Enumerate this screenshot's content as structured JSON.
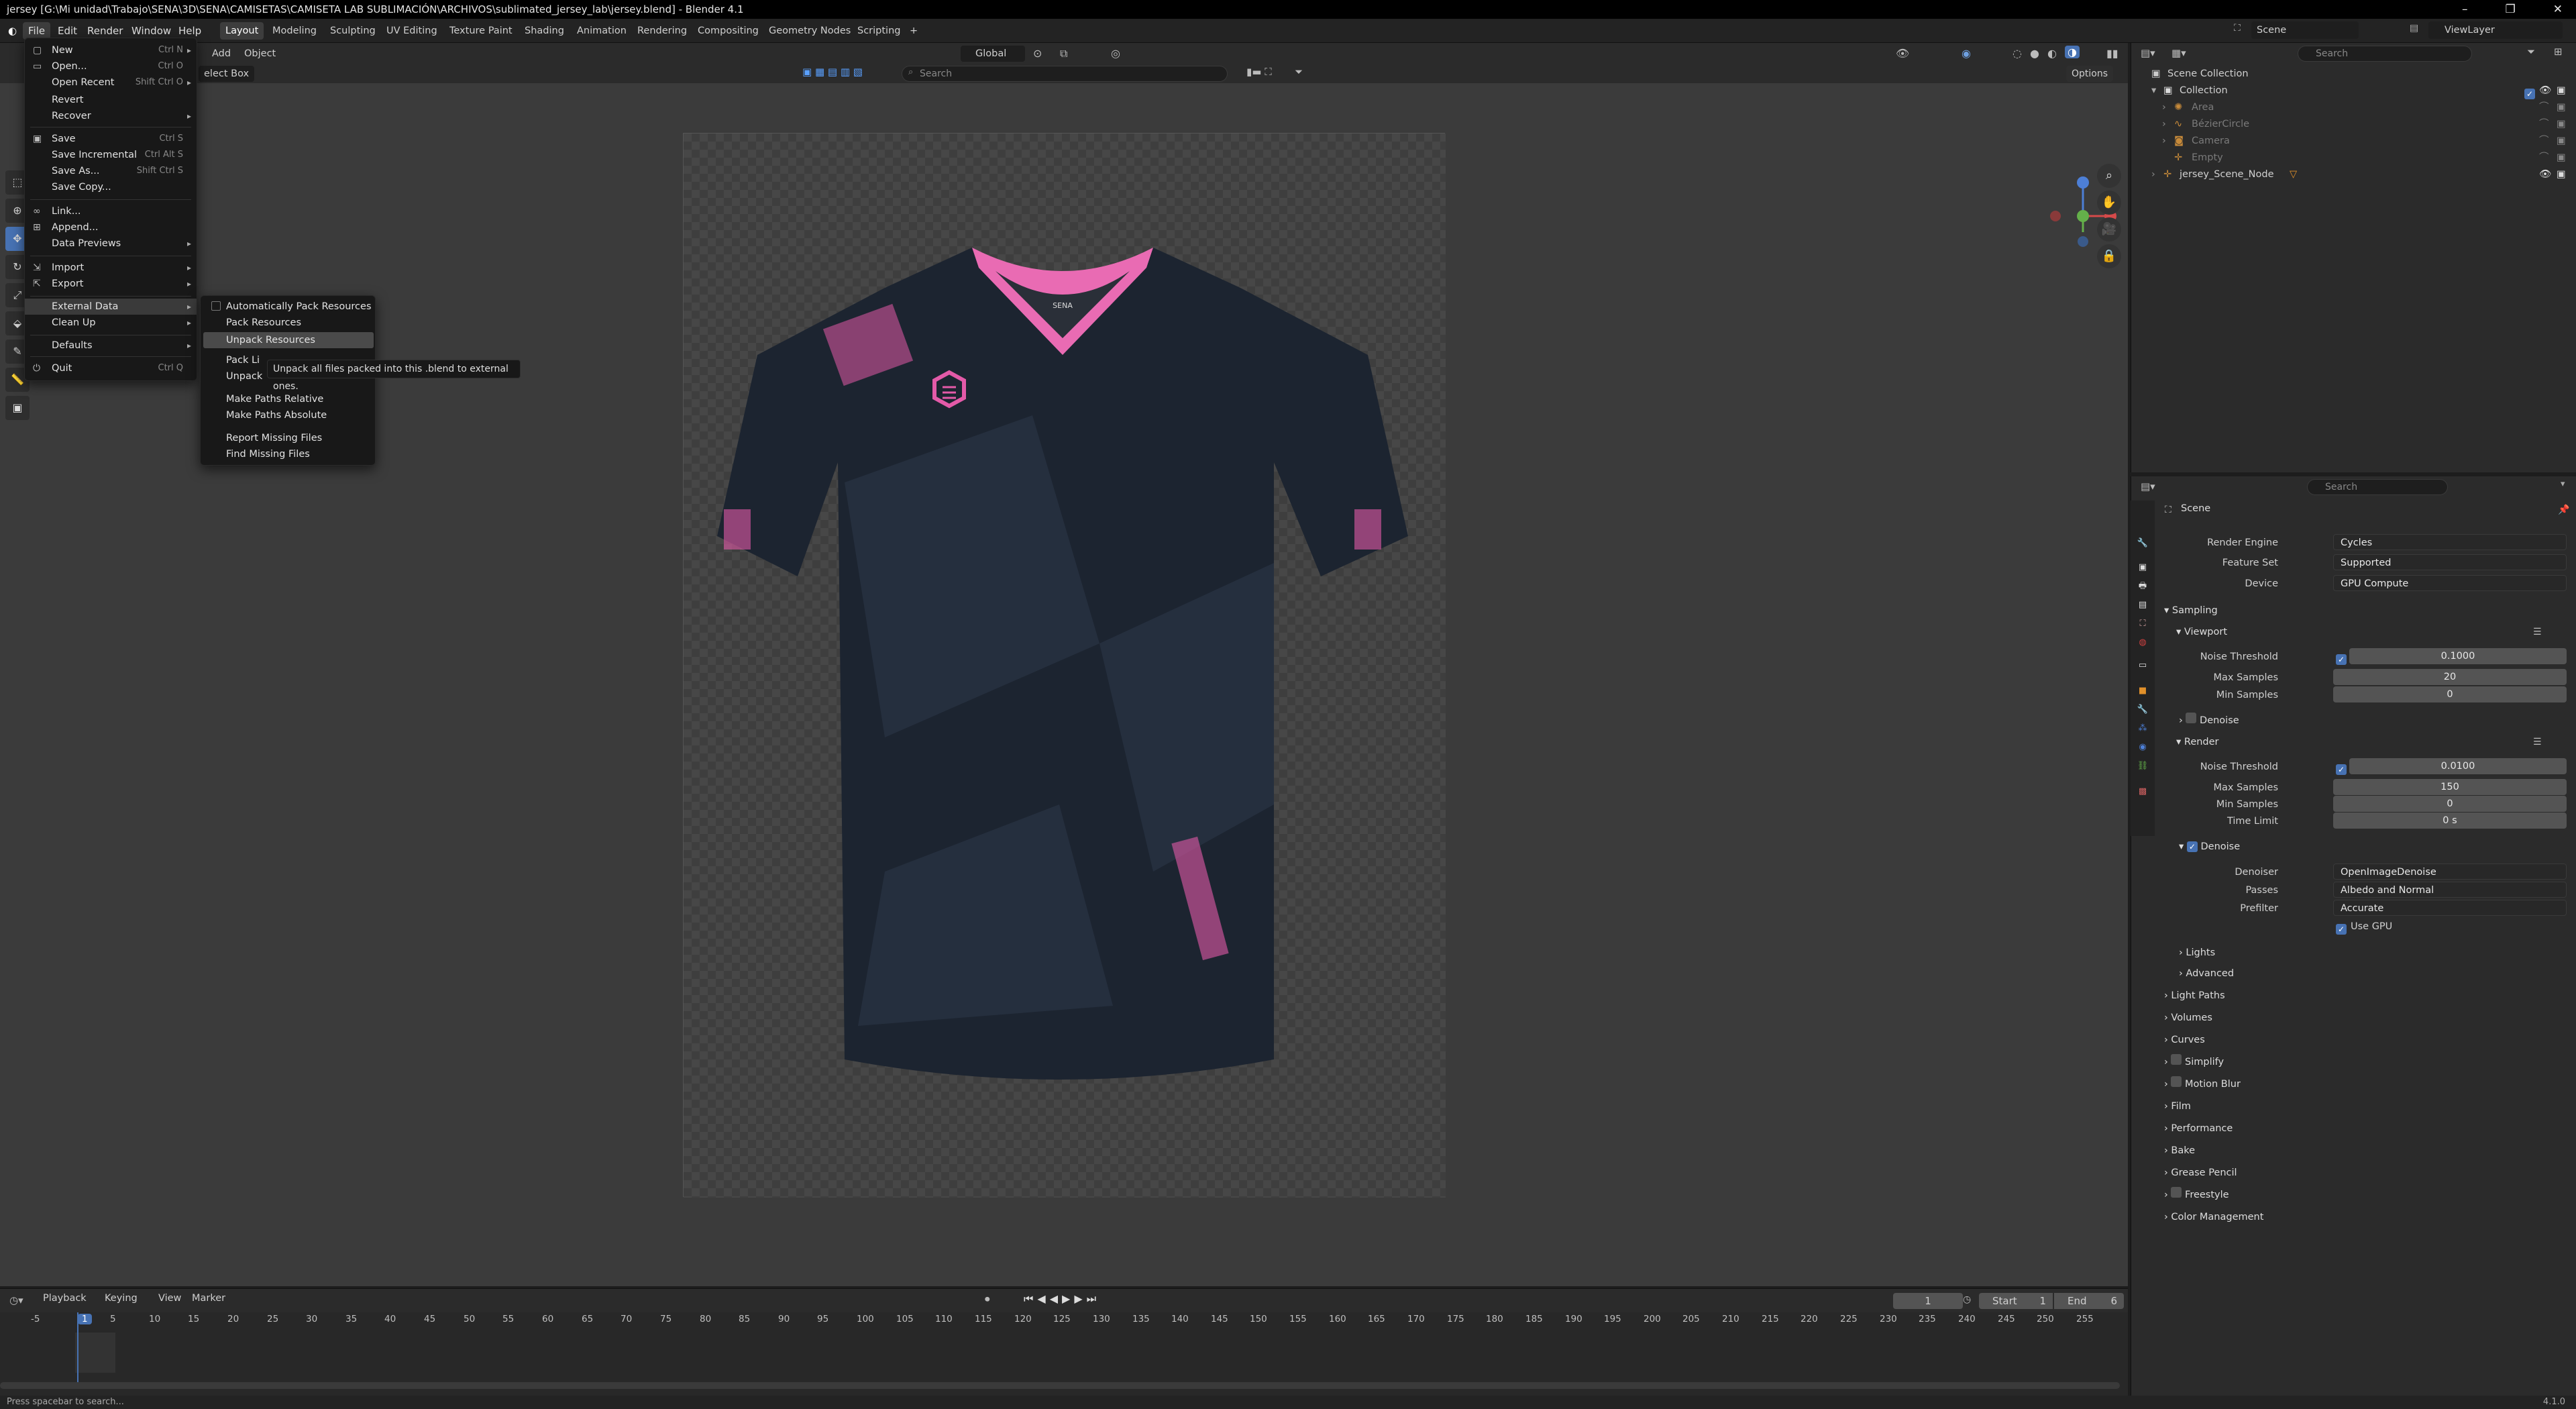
{
  "window": {
    "title": "jersey [G:\\Mi unidad\\Trabajo\\SENA\\3D\\SENA\\CAMISETAS\\CAMISETA LAB SUBLIMACIÓN\\ARCHIVOS\\sublimated_jersey_lab\\jersey.blend] - Blender 4.1",
    "min": "–",
    "max": "❐",
    "close": "✕"
  },
  "menubar": [
    "File",
    "Edit",
    "Render",
    "Window",
    "Help"
  ],
  "workspaces": [
    "Layout",
    "Modeling",
    "Sculpting",
    "UV Editing",
    "Texture Paint",
    "Shading",
    "Animation",
    "Rendering",
    "Compositing",
    "Geometry Nodes",
    "Scripting",
    "+"
  ],
  "scene": {
    "label": "Scene",
    "viewlayer": "ViewLayer"
  },
  "viewport": {
    "add": "Add",
    "object": "Object",
    "select_box": "elect Box",
    "transform": "Global",
    "search_placeholder": "Search",
    "options": "Options"
  },
  "file_menu": [
    {
      "label": "New",
      "shortcut": "Ctrl N",
      "icon": "new-icon",
      "arrow": true
    },
    {
      "label": "Open...",
      "shortcut": "Ctrl O",
      "icon": "folder-icon"
    },
    {
      "label": "Open Recent",
      "shortcut": "Shift Ctrl O",
      "arrow": true
    },
    {
      "label": "Revert"
    },
    {
      "label": "Recover",
      "arrow": true
    },
    {
      "label": "Save",
      "shortcut": "Ctrl S",
      "icon": "save-icon"
    },
    {
      "label": "Save Incremental",
      "shortcut": "Ctrl Alt S"
    },
    {
      "label": "Save As...",
      "shortcut": "Shift Ctrl S"
    },
    {
      "label": "Save Copy..."
    },
    {
      "label": "Link...",
      "icon": "link-icon"
    },
    {
      "label": "Append...",
      "icon": "append-icon"
    },
    {
      "label": "Data Previews",
      "arrow": true
    },
    {
      "label": "Import",
      "arrow": true,
      "icon": "import-icon"
    },
    {
      "label": "Export",
      "arrow": true,
      "icon": "export-icon"
    },
    {
      "label": "External Data",
      "arrow": true,
      "highlight": true
    },
    {
      "label": "Clean Up",
      "arrow": true
    },
    {
      "label": "Defaults",
      "arrow": true
    },
    {
      "label": "Quit",
      "shortcut": "Ctrl Q",
      "icon": "quit-icon"
    }
  ],
  "external_data_menu": [
    {
      "label": "Automatically Pack Resources",
      "checkbox": true
    },
    {
      "label": "Pack Resources"
    },
    {
      "label": "Unpack Resources",
      "highlight": true
    },
    {
      "label": "Pack Li"
    },
    {
      "label": "Unpack"
    },
    {
      "label": "Make Paths Relative"
    },
    {
      "label": "Make Paths Absolute"
    },
    {
      "label": "Report Missing Files"
    },
    {
      "label": "Find Missing Files"
    }
  ],
  "tooltip": "Unpack all files packed into this .blend to external ones.",
  "outliner": {
    "search_placeholder": "Search",
    "items": [
      {
        "label": "Scene Collection",
        "indent": 0,
        "color": "#d0d0d0"
      },
      {
        "label": "Collection",
        "indent": 1,
        "color": "#d0d0d0"
      },
      {
        "label": "Area",
        "indent": 2,
        "color": "#7a7a7a"
      },
      {
        "label": "BézierCircle",
        "indent": 2,
        "color": "#7a7a7a"
      },
      {
        "label": "Camera",
        "indent": 2,
        "color": "#7a7a7a"
      },
      {
        "label": "Empty",
        "indent": 2,
        "color": "#7a7a7a"
      },
      {
        "label": "jersey_Scene_Node",
        "indent": 1,
        "color": "#d0d0d0"
      }
    ]
  },
  "properties": {
    "search_placeholder": "Search",
    "context": "Scene",
    "render_engine": {
      "label": "Render Engine",
      "value": "Cycles"
    },
    "feature_set": {
      "label": "Feature Set",
      "value": "Supported"
    },
    "device": {
      "label": "Device",
      "value": "GPU Compute"
    },
    "sampling": "Sampling",
    "viewport": "Viewport",
    "vp_noise_threshold": {
      "label": "Noise Threshold",
      "value": "0.1000"
    },
    "vp_max_samples": {
      "label": "Max Samples",
      "value": "20"
    },
    "vp_min_samples": {
      "label": "Min Samples",
      "value": "0"
    },
    "vp_denoise": "Denoise",
    "render": "Render",
    "r_noise_threshold": {
      "label": "Noise Threshold",
      "value": "0.0100"
    },
    "r_max_samples": {
      "label": "Max Samples",
      "value": "150"
    },
    "r_min_samples": {
      "label": "Min Samples",
      "value": "0"
    },
    "r_time_limit": {
      "label": "Time Limit",
      "value": "0 s"
    },
    "r_denoise": "Denoise",
    "denoiser": {
      "label": "Denoiser",
      "value": "OpenImageDenoise"
    },
    "passes": {
      "label": "Passes",
      "value": "Albedo and Normal"
    },
    "prefilter": {
      "label": "Prefilter",
      "value": "Accurate"
    },
    "use_gpu": "Use GPU",
    "lights": "Lights",
    "advanced": "Advanced",
    "panels": [
      "Light Paths",
      "Volumes",
      "Curves",
      "Simplify",
      "Motion Blur",
      "Film",
      "Performance",
      "Bake",
      "Grease Pencil",
      "Freestyle",
      "Color Management"
    ]
  },
  "timeline": {
    "menus": [
      "Playback",
      "Keying",
      "View",
      "Marker"
    ],
    "current_frame": "1",
    "start_label": "Start",
    "start": "1",
    "end_label": "End",
    "end": "6",
    "ticks": [
      "-5",
      "1",
      "5",
      "10",
      "15",
      "20",
      "25",
      "30",
      "35",
      "40",
      "45",
      "50",
      "55",
      "60",
      "65",
      "70",
      "75",
      "80",
      "85",
      "90",
      "95",
      "100",
      "105",
      "110",
      "115",
      "120",
      "125",
      "130",
      "135",
      "140",
      "145",
      "150",
      "155",
      "160",
      "165",
      "170",
      "175",
      "180",
      "185",
      "190",
      "195",
      "200",
      "205",
      "210",
      "215",
      "220",
      "225",
      "230",
      "235",
      "240",
      "245",
      "250",
      "255"
    ]
  },
  "status": {
    "hint": "Press spacebar to search...",
    "version": "4.1.0"
  },
  "jersey": {
    "logo_text": "SENA",
    "colors": {
      "body": "#1c2430",
      "accent": "#e35aa8",
      "collar": "#e96bb3"
    }
  }
}
